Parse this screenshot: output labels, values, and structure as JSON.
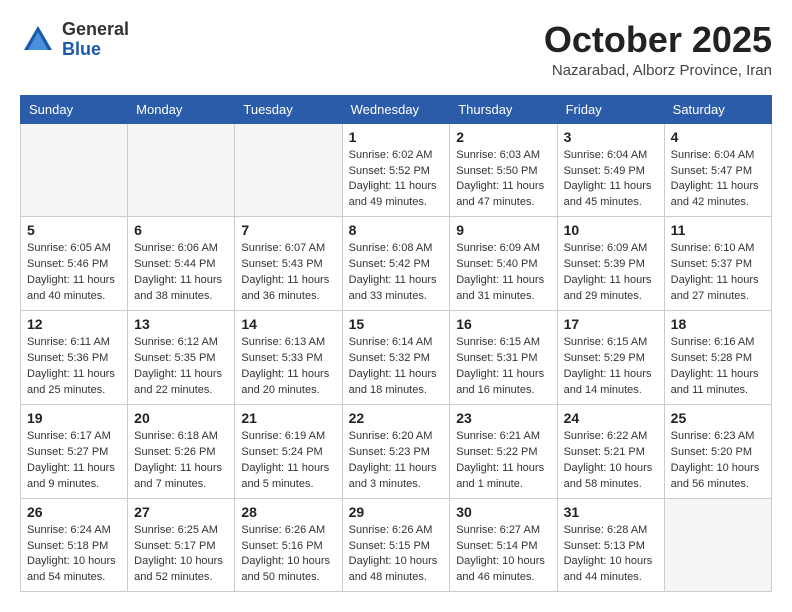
{
  "header": {
    "logo_general": "General",
    "logo_blue": "Blue",
    "month": "October 2025",
    "location": "Nazarabad, Alborz Province, Iran"
  },
  "weekdays": [
    "Sunday",
    "Monday",
    "Tuesday",
    "Wednesday",
    "Thursday",
    "Friday",
    "Saturday"
  ],
  "weeks": [
    [
      {
        "day": "",
        "info": ""
      },
      {
        "day": "",
        "info": ""
      },
      {
        "day": "",
        "info": ""
      },
      {
        "day": "1",
        "info": "Sunrise: 6:02 AM\nSunset: 5:52 PM\nDaylight: 11 hours\nand 49 minutes."
      },
      {
        "day": "2",
        "info": "Sunrise: 6:03 AM\nSunset: 5:50 PM\nDaylight: 11 hours\nand 47 minutes."
      },
      {
        "day": "3",
        "info": "Sunrise: 6:04 AM\nSunset: 5:49 PM\nDaylight: 11 hours\nand 45 minutes."
      },
      {
        "day": "4",
        "info": "Sunrise: 6:04 AM\nSunset: 5:47 PM\nDaylight: 11 hours\nand 42 minutes."
      }
    ],
    [
      {
        "day": "5",
        "info": "Sunrise: 6:05 AM\nSunset: 5:46 PM\nDaylight: 11 hours\nand 40 minutes."
      },
      {
        "day": "6",
        "info": "Sunrise: 6:06 AM\nSunset: 5:44 PM\nDaylight: 11 hours\nand 38 minutes."
      },
      {
        "day": "7",
        "info": "Sunrise: 6:07 AM\nSunset: 5:43 PM\nDaylight: 11 hours\nand 36 minutes."
      },
      {
        "day": "8",
        "info": "Sunrise: 6:08 AM\nSunset: 5:42 PM\nDaylight: 11 hours\nand 33 minutes."
      },
      {
        "day": "9",
        "info": "Sunrise: 6:09 AM\nSunset: 5:40 PM\nDaylight: 11 hours\nand 31 minutes."
      },
      {
        "day": "10",
        "info": "Sunrise: 6:09 AM\nSunset: 5:39 PM\nDaylight: 11 hours\nand 29 minutes."
      },
      {
        "day": "11",
        "info": "Sunrise: 6:10 AM\nSunset: 5:37 PM\nDaylight: 11 hours\nand 27 minutes."
      }
    ],
    [
      {
        "day": "12",
        "info": "Sunrise: 6:11 AM\nSunset: 5:36 PM\nDaylight: 11 hours\nand 25 minutes."
      },
      {
        "day": "13",
        "info": "Sunrise: 6:12 AM\nSunset: 5:35 PM\nDaylight: 11 hours\nand 22 minutes."
      },
      {
        "day": "14",
        "info": "Sunrise: 6:13 AM\nSunset: 5:33 PM\nDaylight: 11 hours\nand 20 minutes."
      },
      {
        "day": "15",
        "info": "Sunrise: 6:14 AM\nSunset: 5:32 PM\nDaylight: 11 hours\nand 18 minutes."
      },
      {
        "day": "16",
        "info": "Sunrise: 6:15 AM\nSunset: 5:31 PM\nDaylight: 11 hours\nand 16 minutes."
      },
      {
        "day": "17",
        "info": "Sunrise: 6:15 AM\nSunset: 5:29 PM\nDaylight: 11 hours\nand 14 minutes."
      },
      {
        "day": "18",
        "info": "Sunrise: 6:16 AM\nSunset: 5:28 PM\nDaylight: 11 hours\nand 11 minutes."
      }
    ],
    [
      {
        "day": "19",
        "info": "Sunrise: 6:17 AM\nSunset: 5:27 PM\nDaylight: 11 hours\nand 9 minutes."
      },
      {
        "day": "20",
        "info": "Sunrise: 6:18 AM\nSunset: 5:26 PM\nDaylight: 11 hours\nand 7 minutes."
      },
      {
        "day": "21",
        "info": "Sunrise: 6:19 AM\nSunset: 5:24 PM\nDaylight: 11 hours\nand 5 minutes."
      },
      {
        "day": "22",
        "info": "Sunrise: 6:20 AM\nSunset: 5:23 PM\nDaylight: 11 hours\nand 3 minutes."
      },
      {
        "day": "23",
        "info": "Sunrise: 6:21 AM\nSunset: 5:22 PM\nDaylight: 11 hours\nand 1 minute."
      },
      {
        "day": "24",
        "info": "Sunrise: 6:22 AM\nSunset: 5:21 PM\nDaylight: 10 hours\nand 58 minutes."
      },
      {
        "day": "25",
        "info": "Sunrise: 6:23 AM\nSunset: 5:20 PM\nDaylight: 10 hours\nand 56 minutes."
      }
    ],
    [
      {
        "day": "26",
        "info": "Sunrise: 6:24 AM\nSunset: 5:18 PM\nDaylight: 10 hours\nand 54 minutes."
      },
      {
        "day": "27",
        "info": "Sunrise: 6:25 AM\nSunset: 5:17 PM\nDaylight: 10 hours\nand 52 minutes."
      },
      {
        "day": "28",
        "info": "Sunrise: 6:26 AM\nSunset: 5:16 PM\nDaylight: 10 hours\nand 50 minutes."
      },
      {
        "day": "29",
        "info": "Sunrise: 6:26 AM\nSunset: 5:15 PM\nDaylight: 10 hours\nand 48 minutes."
      },
      {
        "day": "30",
        "info": "Sunrise: 6:27 AM\nSunset: 5:14 PM\nDaylight: 10 hours\nand 46 minutes."
      },
      {
        "day": "31",
        "info": "Sunrise: 6:28 AM\nSunset: 5:13 PM\nDaylight: 10 hours\nand 44 minutes."
      },
      {
        "day": "",
        "info": ""
      }
    ]
  ]
}
